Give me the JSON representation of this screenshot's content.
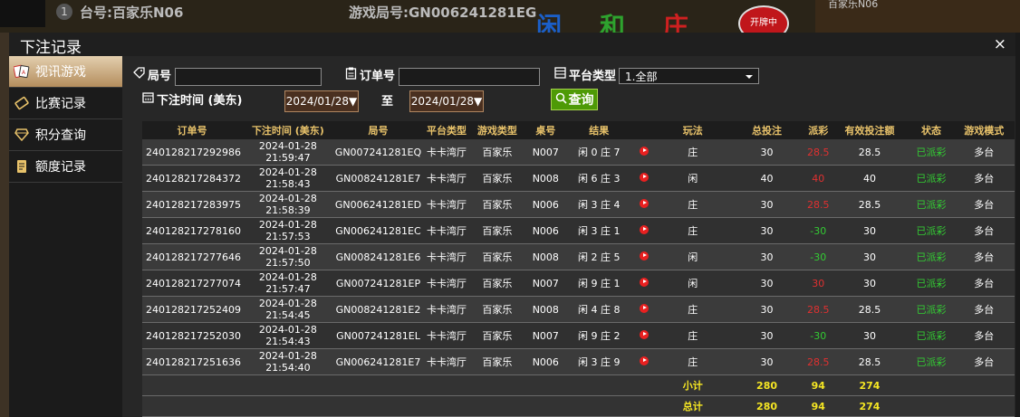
{
  "background": {
    "table_label": "台号:百家乐N06",
    "game_no_label": "游戏局号:GN006241281EG",
    "circle_num": "1",
    "char_xian": "闲",
    "char_he": "和",
    "char_zhuang": "庄",
    "red_btn": "开牌中",
    "right_label": "百家乐N06"
  },
  "modal": {
    "title": "下注记录",
    "close": "×"
  },
  "sidebar": {
    "items": [
      {
        "label": "视讯游戏",
        "icon": "cards-icon",
        "active": true
      },
      {
        "label": "比赛记录",
        "icon": "ticket-icon",
        "active": false
      },
      {
        "label": "积分查询",
        "icon": "diamond-icon",
        "active": false
      },
      {
        "label": "额度记录",
        "icon": "document-icon",
        "active": false
      }
    ]
  },
  "filters": {
    "round_label": "局号",
    "order_label": "订单号",
    "platform_label": "平台类型",
    "platform_value": "1.全部",
    "time_label": "下注时间 (美东)",
    "date_from": "2024/01/28▼",
    "to_label": "至",
    "date_to": "2024/01/28▼",
    "query_label": "查询"
  },
  "table": {
    "headers": [
      "订单号",
      "下注时间 (美东)",
      "局号",
      "平台类型",
      "游戏类型",
      "桌号",
      "结果",
      "",
      "玩法",
      "总投注",
      "派彩",
      "有效投注额",
      "状态",
      "游戏模式"
    ],
    "rows": [
      [
        "240128217292986",
        "2024-01-28 21:59:47",
        "GN007241281EQ",
        "卡卡湾厅",
        "百家乐",
        "N007",
        "闲 0 庄 7",
        "",
        "庄",
        "30",
        "28.5",
        "28.5",
        "已派彩",
        "多台"
      ],
      [
        "240128217284372",
        "2024-01-28 21:58:43",
        "GN008241281E7",
        "卡卡湾厅",
        "百家乐",
        "N008",
        "闲 6 庄 3",
        "",
        "闲",
        "40",
        "40",
        "40",
        "已派彩",
        "多台"
      ],
      [
        "240128217283975",
        "2024-01-28 21:58:39",
        "GN006241281ED",
        "卡卡湾厅",
        "百家乐",
        "N006",
        "闲 3 庄 4",
        "",
        "庄",
        "30",
        "28.5",
        "28.5",
        "已派彩",
        "多台"
      ],
      [
        "240128217278160",
        "2024-01-28 21:57:53",
        "GN006241281EC",
        "卡卡湾厅",
        "百家乐",
        "N006",
        "闲 3 庄 1",
        "",
        "庄",
        "30",
        "-30",
        "30",
        "已派彩",
        "多台"
      ],
      [
        "240128217277646",
        "2024-01-28 21:57:50",
        "GN008241281E6",
        "卡卡湾厅",
        "百家乐",
        "N008",
        "闲 2 庄 5",
        "",
        "闲",
        "30",
        "-30",
        "30",
        "已派彩",
        "多台"
      ],
      [
        "240128217277074",
        "2024-01-28 21:57:47",
        "GN007241281EP",
        "卡卡湾厅",
        "百家乐",
        "N007",
        "闲 9 庄 1",
        "",
        "闲",
        "30",
        "30",
        "30",
        "已派彩",
        "多台"
      ],
      [
        "240128217252409",
        "2024-01-28 21:54:45",
        "GN008241281E2",
        "卡卡湾厅",
        "百家乐",
        "N008",
        "闲 4 庄 8",
        "",
        "庄",
        "30",
        "28.5",
        "28.5",
        "已派彩",
        "多台"
      ],
      [
        "240128217252030",
        "2024-01-28 21:54:43",
        "GN007241281EL",
        "卡卡湾厅",
        "百家乐",
        "N007",
        "闲 9 庄 2",
        "",
        "庄",
        "30",
        "-30",
        "30",
        "已派彩",
        "多台"
      ],
      [
        "240128217251636",
        "2024-01-28 21:54:40",
        "GN006241281E7",
        "卡卡湾厅",
        "百家乐",
        "N006",
        "闲 3 庄 9",
        "",
        "庄",
        "30",
        "28.5",
        "28.5",
        "已派彩",
        "多台"
      ]
    ],
    "subtotal": {
      "label": "小计",
      "total_bet": "280",
      "payout": "94",
      "valid": "274"
    },
    "total": {
      "label": "总计",
      "total_bet": "280",
      "payout": "94",
      "valid": "274"
    }
  },
  "colors": {
    "header_text": "#e8c26a",
    "sum_text": "#f5e623",
    "negative": "#33cc33",
    "positive": "#e03030",
    "query_btn": "#4e9a06"
  }
}
